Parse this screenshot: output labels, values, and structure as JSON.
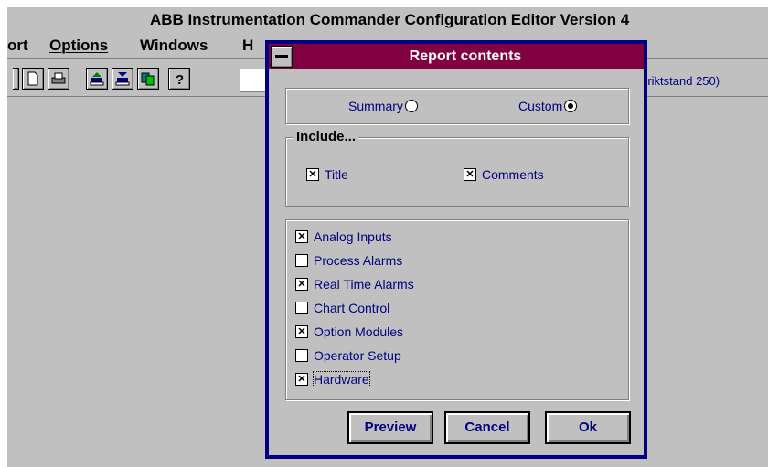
{
  "app": {
    "title": "ABB Instrumentation   Commander Configuration Editor Version 4",
    "menu": [
      "ort",
      "Options",
      "Windows",
      "H"
    ],
    "status_text": "(riktstand 250)"
  },
  "toolbar": {
    "icons": [
      "new-document-icon",
      "print-icon",
      "load-icon",
      "save-load-icon",
      "copy-icon",
      "help-icon"
    ]
  },
  "dialog": {
    "title": "Report contents",
    "mode": {
      "summary_label": "Summary",
      "custom_label": "Custom",
      "selected": "Custom"
    },
    "include": {
      "legend": "Include...",
      "title_label": "Title",
      "title_checked": true,
      "comments_label": "Comments",
      "comments_checked": true
    },
    "items": [
      {
        "label": "Analog Inputs",
        "checked": true
      },
      {
        "label": "Process Alarms",
        "checked": false
      },
      {
        "label": "Real Time Alarms",
        "checked": true
      },
      {
        "label": "Chart Control",
        "checked": false
      },
      {
        "label": "Option Modules",
        "checked": true
      },
      {
        "label": "Operator Setup",
        "checked": false
      },
      {
        "label": "Hardware",
        "checked": true
      }
    ],
    "buttons": {
      "preview": "Preview",
      "cancel": "Cancel",
      "ok": "Ok"
    }
  }
}
